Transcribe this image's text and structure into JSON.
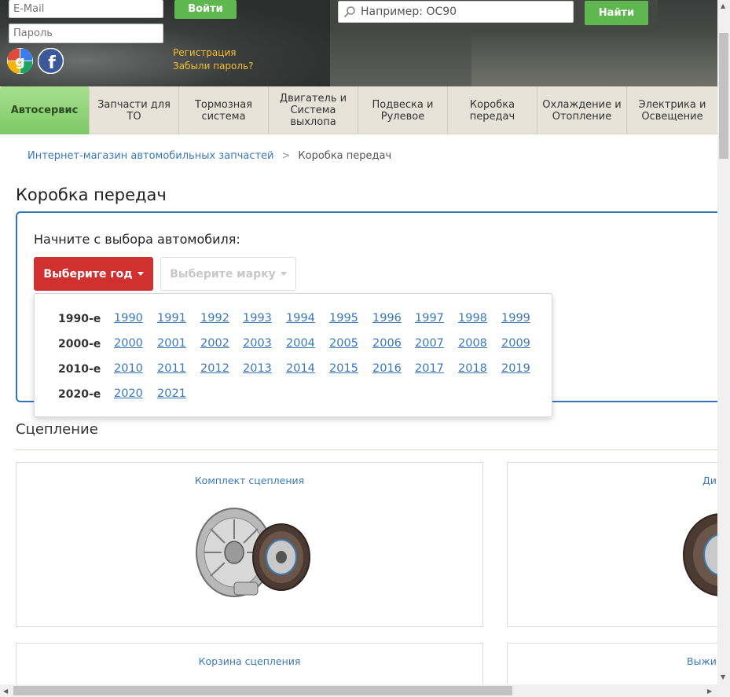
{
  "header": {
    "email_placeholder": "E-Mail",
    "password_placeholder": "Пароль",
    "login_button": "Войти",
    "register_link": "Регистрация",
    "forgot_link": "Забыли пароль?",
    "search_placeholder": "Например: OC90",
    "search_button": "Найти"
  },
  "nav": {
    "items": [
      {
        "label": "Автосервис"
      },
      {
        "label": "Запчасти для ТО"
      },
      {
        "label": "Тормозная система"
      },
      {
        "label": "Двигатель и Система выхлопа"
      },
      {
        "label": "Подвеска и Рулевое"
      },
      {
        "label": "Коробка передач"
      },
      {
        "label": "Охлаждение и Отопление"
      },
      {
        "label": "Электрика и Освещение"
      }
    ]
  },
  "breadcrumb": {
    "home": "Интернет-магазин автомобильных запчастей",
    "separator": ">",
    "current": "Коробка передач"
  },
  "page_title": "Коробка передач",
  "selector": {
    "label": "Начните с выбора автомобиля:",
    "year_button": "Выберите год",
    "brand_button": "Выберите марку",
    "decades": [
      {
        "label": "1990-е",
        "years": [
          "1990",
          "1991",
          "1992",
          "1993",
          "1994",
          "1995",
          "1996",
          "1997",
          "1998",
          "1999"
        ]
      },
      {
        "label": "2000-е",
        "years": [
          "2000",
          "2001",
          "2002",
          "2003",
          "2004",
          "2005",
          "2006",
          "2007",
          "2008",
          "2009"
        ]
      },
      {
        "label": "2010-е",
        "years": [
          "2010",
          "2011",
          "2012",
          "2013",
          "2014",
          "2015",
          "2016",
          "2017",
          "2018",
          "2019"
        ]
      },
      {
        "label": "2020-е",
        "years": [
          "2020",
          "2021"
        ]
      }
    ]
  },
  "section": {
    "title": "Сцепление",
    "cards": [
      {
        "title": "Комплект сцепления"
      },
      {
        "title": "Ди"
      },
      {
        "title": "Корзина сцепления"
      },
      {
        "title": "Выжим"
      }
    ]
  },
  "colors": {
    "accent_green": "#5fb84f",
    "accent_red": "#d03030",
    "link_blue": "#3a78b5",
    "selector_border": "#2f73ba"
  }
}
